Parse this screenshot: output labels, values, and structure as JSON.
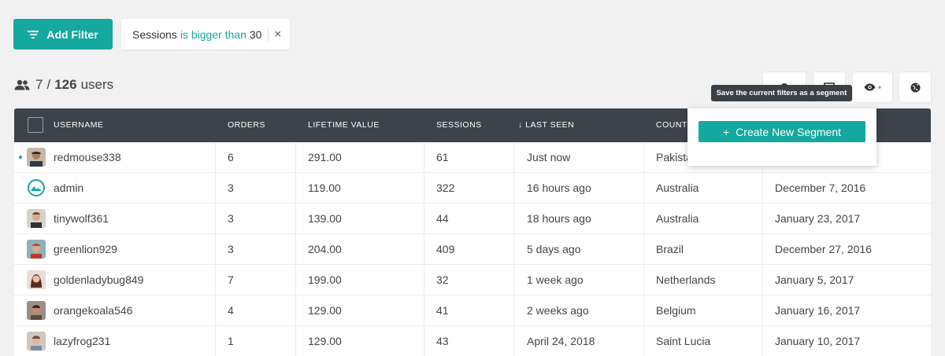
{
  "filter_button": {
    "label": "Add Filter",
    "icon": "filter-icon"
  },
  "active_filter": {
    "field": "Sessions",
    "operator": "is bigger than",
    "value": "30",
    "remove_icon": "close-icon",
    "remove_glyph": "×"
  },
  "user_count": {
    "shown": "7",
    "separator": "/",
    "total": "126",
    "unit": "users",
    "icon": "users-icon"
  },
  "toolbar": {
    "segment_icon": "segment-icon",
    "columns_icon": "columns-icon",
    "view_icon": "eye-icon",
    "view_caret": "▾",
    "globe_icon": "globe-icon"
  },
  "tooltip": {
    "text": "Save the current filters as a segment"
  },
  "segment_dropdown": {
    "button_icon": "+",
    "button_label": "Create New Segment"
  },
  "table": {
    "columns": {
      "username": "USERNAME",
      "orders": "ORDERS",
      "lifetime_value": "LIFETIME VALUE",
      "sessions": "SESSIONS",
      "last_seen": "LAST SEEN",
      "last_seen_sort": "↓",
      "country": "COUNTRY",
      "signed_up": ""
    },
    "rows": [
      {
        "username": "redmouse338",
        "orders": "6",
        "lifetime_value": "291.00",
        "sessions": "61",
        "last_seen": "Just now",
        "country": "Pakistan",
        "signed_up": "",
        "online": true
      },
      {
        "username": "admin",
        "orders": "3",
        "lifetime_value": "119.00",
        "sessions": "322",
        "last_seen": "16 hours ago",
        "country": "Australia",
        "signed_up": "December 7, 2016"
      },
      {
        "username": "tinywolf361",
        "orders": "3",
        "lifetime_value": "139.00",
        "sessions": "44",
        "last_seen": "18 hours ago",
        "country": "Australia",
        "signed_up": "January 23, 2017"
      },
      {
        "username": "greenlion929",
        "orders": "3",
        "lifetime_value": "204.00",
        "sessions": "409",
        "last_seen": "5 days ago",
        "country": "Brazil",
        "signed_up": "December 27, 2016"
      },
      {
        "username": "goldenladybug849",
        "orders": "7",
        "lifetime_value": "199.00",
        "sessions": "32",
        "last_seen": "1 week ago",
        "country": "Netherlands",
        "signed_up": "January 5, 2017"
      },
      {
        "username": "orangekoala546",
        "orders": "4",
        "lifetime_value": "129.00",
        "sessions": "41",
        "last_seen": "2 weeks ago",
        "country": "Belgium",
        "signed_up": "January 16, 2017"
      },
      {
        "username": "lazyfrog231",
        "orders": "1",
        "lifetime_value": "129.00",
        "sessions": "43",
        "last_seen": "April 24, 2018",
        "country": "Saint Lucia",
        "signed_up": "January 10, 2017"
      }
    ]
  },
  "colors": {
    "accent": "#14a8a0",
    "header_bg": "#3d434a",
    "tooltip_bg": "#3b3f46",
    "page_bg": "#f1f1f1"
  }
}
